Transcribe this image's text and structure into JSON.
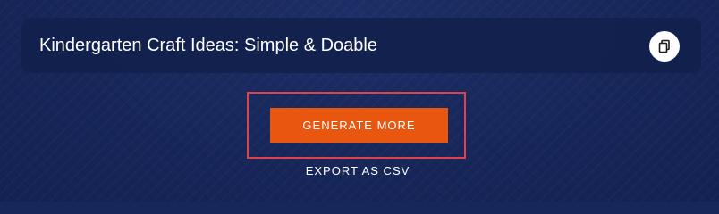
{
  "title_card": {
    "title": "Kindergarten Craft Ideas: Simple & Doable",
    "copy_icon": "copy-icon"
  },
  "actions": {
    "generate_label": "GENERATE MORE",
    "export_label": "EXPORT AS CSV"
  },
  "colors": {
    "background": "#17275a",
    "card": "#12204c",
    "accent": "#e9560f",
    "highlight_border": "#e0414d"
  }
}
